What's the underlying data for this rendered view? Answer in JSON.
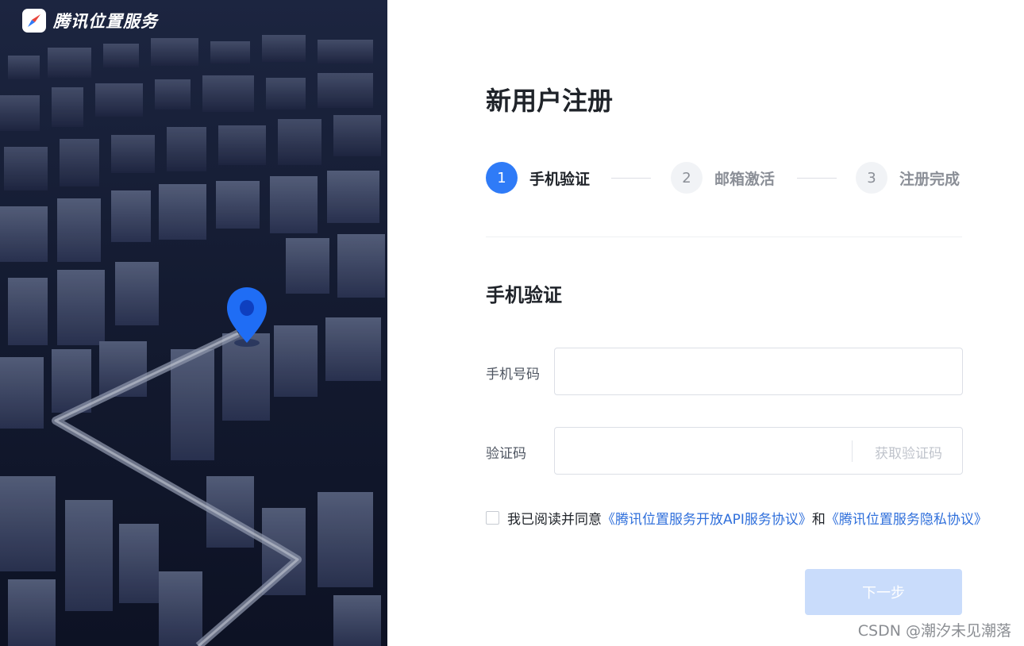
{
  "brand": {
    "name": "腾讯位置服务"
  },
  "page": {
    "title": "新用户注册"
  },
  "steps": [
    {
      "number": "1",
      "label": "手机验证",
      "state": "active"
    },
    {
      "number": "2",
      "label": "邮箱激活",
      "state": "pending"
    },
    {
      "number": "3",
      "label": "注册完成",
      "state": "pending"
    }
  ],
  "section": {
    "title": "手机验证"
  },
  "form": {
    "phone": {
      "label": "手机号码",
      "value": ""
    },
    "code": {
      "label": "验证码",
      "value": "",
      "get_code_label": "获取验证码"
    }
  },
  "agreement": {
    "prefix": "我已阅读并同意",
    "link1": "《腾讯位置服务开放API服务协议》",
    "joiner": "和",
    "link2": "《腾讯位置服务隐私协议》",
    "checked": false
  },
  "next_button": {
    "label": "下一步",
    "enabled": false
  },
  "watermark": "CSDN @潮汐未见潮落",
  "colors": {
    "primary": "#2f7bf7",
    "primary_disabled": "#c9dcfb",
    "link": "#2f6fdb",
    "hero_bg": "#141b31"
  }
}
